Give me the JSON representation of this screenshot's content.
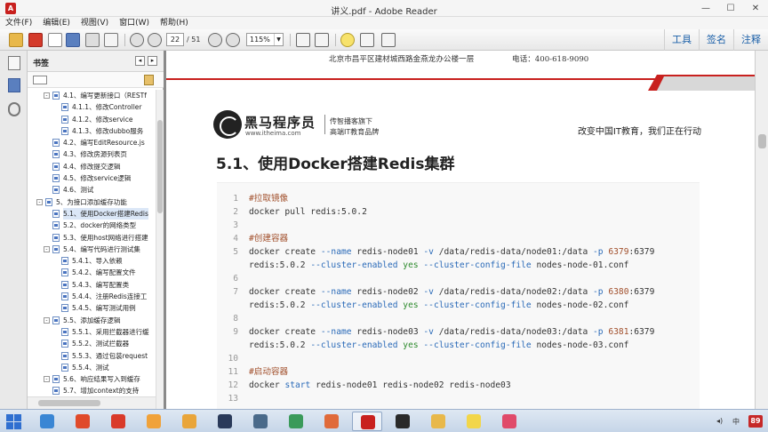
{
  "window": {
    "title": "讲义.pdf - Adobe Reader",
    "controls": {
      "minimize": "—",
      "maximize": "☐",
      "close": "✕"
    }
  },
  "menu": [
    "文件(F)",
    "编辑(E)",
    "视图(V)",
    "窗口(W)",
    "帮助(H)"
  ],
  "toolbar": {
    "page_current": "22",
    "page_total": "/ 51",
    "zoom": "115%",
    "right_buttons": [
      "工具",
      "签名",
      "注释"
    ]
  },
  "bookmarks": {
    "header": "书签",
    "items": [
      {
        "text": "4.1、编写更新接口（RESTf",
        "level": 2,
        "exp": "-",
        "sel": false
      },
      {
        "text": "4.1.1、修改Controller",
        "level": 3,
        "exp": "",
        "sel": false
      },
      {
        "text": "4.1.2、修改service",
        "level": 3,
        "exp": "",
        "sel": false
      },
      {
        "text": "4.1.3、修改dubbo服务",
        "level": 3,
        "exp": "",
        "sel": false
      },
      {
        "text": "4.2、编写EditResource.js",
        "level": 2,
        "exp": "",
        "sel": false
      },
      {
        "text": "4.3、修改房源列表页",
        "level": 2,
        "exp": "",
        "sel": false
      },
      {
        "text": "4.4、修改提交逻辑",
        "level": 2,
        "exp": "",
        "sel": false
      },
      {
        "text": "4.5、修改service逻辑",
        "level": 2,
        "exp": "",
        "sel": false
      },
      {
        "text": "4.6、测试",
        "level": 2,
        "exp": "",
        "sel": false
      },
      {
        "text": "5、为接口添加缓存功能",
        "level": 1,
        "exp": "-",
        "sel": false
      },
      {
        "text": "5.1、使用Docker搭建Redis",
        "level": 2,
        "exp": "",
        "sel": true
      },
      {
        "text": "5.2、docker的网络类型",
        "level": 2,
        "exp": "",
        "sel": false
      },
      {
        "text": "5.3、使用host网络进行搭建",
        "level": 2,
        "exp": "",
        "sel": false
      },
      {
        "text": "5.4、编写代码进行测试集",
        "level": 2,
        "exp": "-",
        "sel": false
      },
      {
        "text": "5.4.1、导入依赖",
        "level": 3,
        "exp": "",
        "sel": false
      },
      {
        "text": "5.4.2、编写配置文件",
        "level": 3,
        "exp": "",
        "sel": false
      },
      {
        "text": "5.4.3、编写配置类",
        "level": 3,
        "exp": "",
        "sel": false
      },
      {
        "text": "5.4.4、注册Redis连接工",
        "level": 3,
        "exp": "",
        "sel": false
      },
      {
        "text": "5.4.5、编写测试用例",
        "level": 3,
        "exp": "",
        "sel": false
      },
      {
        "text": "5.5、添加缓存逻辑",
        "level": 2,
        "exp": "-",
        "sel": false
      },
      {
        "text": "5.5.1、采用拦截器进行缓",
        "level": 3,
        "exp": "",
        "sel": false
      },
      {
        "text": "5.5.2、测试拦截器",
        "level": 3,
        "exp": "",
        "sel": false
      },
      {
        "text": "5.5.3、通过包装request",
        "level": 3,
        "exp": "",
        "sel": false
      },
      {
        "text": "5.5.4、测试",
        "level": 3,
        "exp": "",
        "sel": false
      },
      {
        "text": "5.6、响应结果写入到缓存",
        "level": 2,
        "exp": "-",
        "sel": false
      },
      {
        "text": "5.7、增加context的支持",
        "level": 2,
        "exp": "",
        "sel": false
      }
    ]
  },
  "document": {
    "header_address": "北京市昌平区建材城西路金燕龙办公楼一层",
    "header_phone": "电话：400-618-9090",
    "brand_name": "黑马程序员",
    "brand_url": "www.itheima.com",
    "tagline_1": "传智播客旗下",
    "tagline_2": "高端IT教育品牌",
    "slogan": "改变中国IT教育，我们正在行动",
    "section_title": "5.1、使用Docker搭建Redis集群",
    "code": [
      {
        "n": "1",
        "parts": [
          {
            "t": "#拉取镜像",
            "c": "cm"
          }
        ]
      },
      {
        "n": "2",
        "parts": [
          {
            "t": "docker pull redis:5.0.2",
            "c": ""
          }
        ]
      },
      {
        "n": "3",
        "parts": []
      },
      {
        "n": "4",
        "parts": [
          {
            "t": "#创建容器",
            "c": "cm"
          }
        ]
      },
      {
        "n": "5",
        "parts": [
          {
            "t": "docker create ",
            "c": ""
          },
          {
            "t": "--name",
            "c": "op"
          },
          {
            "t": " redis-node01 ",
            "c": ""
          },
          {
            "t": "-v",
            "c": "op"
          },
          {
            "t": " /data/redis-data/node01:/data ",
            "c": ""
          },
          {
            "t": "-p",
            "c": "op"
          },
          {
            "t": " ",
            "c": ""
          },
          {
            "t": "6379",
            "c": "nm"
          },
          {
            "t": ":6379",
            "c": ""
          }
        ]
      },
      {
        "n": "",
        "parts": [
          {
            "t": "redis:5.0.2 ",
            "c": ""
          },
          {
            "t": "--cluster-enabled",
            "c": "op"
          },
          {
            "t": " ",
            "c": ""
          },
          {
            "t": "yes",
            "c": "kw"
          },
          {
            "t": " ",
            "c": ""
          },
          {
            "t": "--cluster-config-file",
            "c": "op"
          },
          {
            "t": " nodes-node-01.conf",
            "c": ""
          }
        ]
      },
      {
        "n": "6",
        "parts": []
      },
      {
        "n": "7",
        "parts": [
          {
            "t": "docker create ",
            "c": ""
          },
          {
            "t": "--name",
            "c": "op"
          },
          {
            "t": " redis-node02 ",
            "c": ""
          },
          {
            "t": "-v",
            "c": "op"
          },
          {
            "t": " /data/redis-data/node02:/data ",
            "c": ""
          },
          {
            "t": "-p",
            "c": "op"
          },
          {
            "t": " ",
            "c": ""
          },
          {
            "t": "6380",
            "c": "nm"
          },
          {
            "t": ":6379",
            "c": ""
          }
        ]
      },
      {
        "n": "",
        "parts": [
          {
            "t": "redis:5.0.2 ",
            "c": ""
          },
          {
            "t": "--cluster-enabled",
            "c": "op"
          },
          {
            "t": " ",
            "c": ""
          },
          {
            "t": "yes",
            "c": "kw"
          },
          {
            "t": " ",
            "c": ""
          },
          {
            "t": "--cluster-config-file",
            "c": "op"
          },
          {
            "t": " nodes-node-02.conf",
            "c": ""
          }
        ]
      },
      {
        "n": "8",
        "parts": []
      },
      {
        "n": "9",
        "parts": [
          {
            "t": "docker create ",
            "c": ""
          },
          {
            "t": "--name",
            "c": "op"
          },
          {
            "t": " redis-node03 ",
            "c": ""
          },
          {
            "t": "-v",
            "c": "op"
          },
          {
            "t": " /data/redis-data/node03:/data ",
            "c": ""
          },
          {
            "t": "-p",
            "c": "op"
          },
          {
            "t": " ",
            "c": ""
          },
          {
            "t": "6381",
            "c": "nm"
          },
          {
            "t": ":6379",
            "c": ""
          }
        ]
      },
      {
        "n": "",
        "parts": [
          {
            "t": "redis:5.0.2 ",
            "c": ""
          },
          {
            "t": "--cluster-enabled",
            "c": "op"
          },
          {
            "t": " ",
            "c": ""
          },
          {
            "t": "yes",
            "c": "kw"
          },
          {
            "t": " ",
            "c": ""
          },
          {
            "t": "--cluster-config-file",
            "c": "op"
          },
          {
            "t": " nodes-node-03.conf",
            "c": ""
          }
        ]
      },
      {
        "n": "10",
        "parts": []
      },
      {
        "n": "11",
        "parts": [
          {
            "t": "#启动容器",
            "c": "cm"
          }
        ]
      },
      {
        "n": "12",
        "parts": [
          {
            "t": "docker ",
            "c": ""
          },
          {
            "t": "start",
            "c": "op"
          },
          {
            "t": " redis-node01 redis-node02 redis-node03",
            "c": ""
          }
        ]
      },
      {
        "n": "13",
        "parts": []
      }
    ]
  },
  "taskbar": {
    "apps": [
      "ie-icon",
      "chrome-icon",
      "xmind-icon",
      "rainbow-icon",
      "notepad-icon",
      "intellij-icon",
      "terminal-icon",
      "screen-icon",
      "mango-icon",
      "adobe-reader-icon",
      "cmd-icon",
      "fruit-icon",
      "sticky-icon",
      "pen-icon"
    ],
    "tray_lang": "中",
    "tray_badge": "89"
  },
  "colors": {
    "accent": "#1a5fa8",
    "brand_red": "#c8201e",
    "code_bg": "#f8f8f8"
  }
}
